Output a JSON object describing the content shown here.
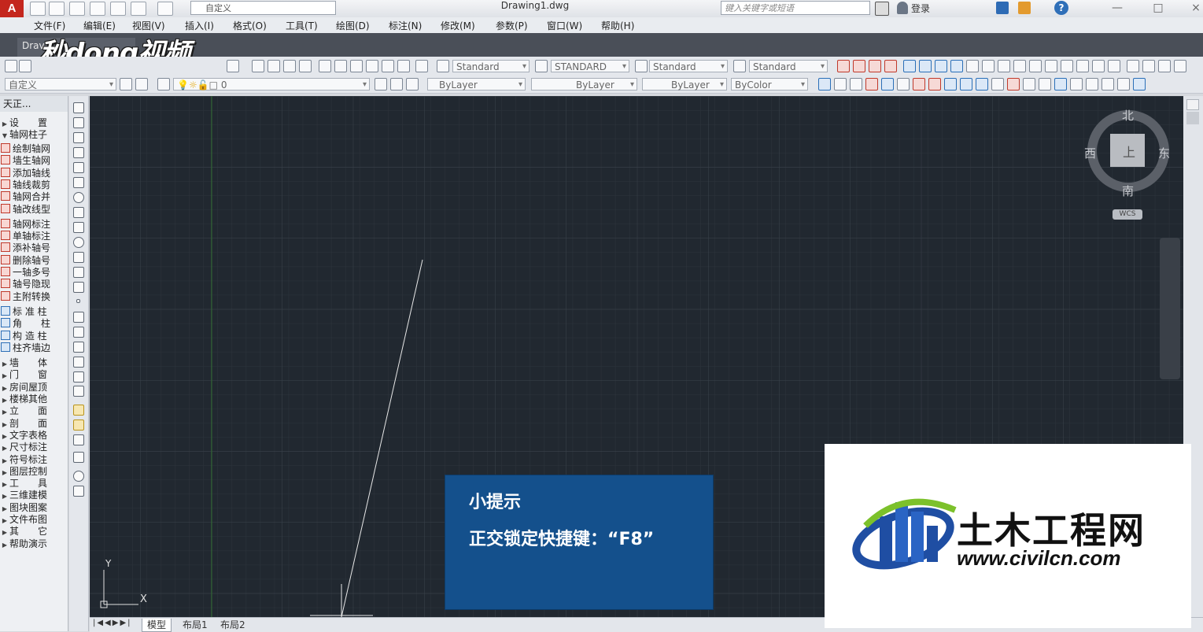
{
  "app": {
    "logo": "A",
    "title": "Drawing1.dwg",
    "workspace": "自定义",
    "search_placeholder": "键入关键字或短语",
    "login": "登录",
    "help": "?"
  },
  "menu": [
    "文件(F)",
    "编辑(E)",
    "视图(V)",
    "插入(I)",
    "格式(O)",
    "工具(T)",
    "绘图(D)",
    "标注(N)",
    "修改(M)",
    "参数(P)",
    "窗口(W)",
    "帮助(H)"
  ],
  "doc_tab": "Drav",
  "overlay_logo": "秒dong视频",
  "styles": {
    "text_style": "Standard",
    "dim_style": "STANDARD",
    "table_style": "Standard",
    "multileader_style": "Standard"
  },
  "layers": {
    "workspace2": "自定义",
    "current_layer": "0",
    "color": "ByLayer",
    "linetype": "ByLayer",
    "lineweight": "ByLayer",
    "plotstyle": "ByColor"
  },
  "palette": {
    "title": "天正...",
    "settings": "设　　置",
    "axis_group": "轴网柱子",
    "axis_items": [
      "绘制轴网",
      "墙生轴网",
      "添加轴线",
      "轴线裁剪",
      "轴网合并",
      "轴改线型",
      "轴网标注",
      "单轴标注",
      "添补轴号",
      "删除轴号",
      "一轴多号",
      "轴号隐现",
      "主附转换",
      "标 准 柱",
      "角　　柱",
      "构 造 柱",
      "柱齐墙边"
    ],
    "groups": [
      "墙　　体",
      "门　　窗",
      "房间屋顶",
      "楼梯其他",
      "立　　面",
      "剖　　面",
      "文字表格",
      "尺寸标注",
      "符号标注",
      "图层控制",
      "工　　具",
      "三维建模",
      "图块图案",
      "文件布图",
      "其　　它",
      "帮助演示"
    ]
  },
  "compass": {
    "north": "北",
    "south": "南",
    "east": "东",
    "west": "西",
    "top": "上",
    "wcs": "WCS"
  },
  "ucs": {
    "x": "X",
    "y": "Y"
  },
  "layout_tabs": [
    "模型",
    "布局1",
    "布局2"
  ],
  "hint": {
    "title": "小提示",
    "text": "正交锁定快捷键：“F8”"
  },
  "watermark": {
    "title": "土木工程网",
    "url": "www.civilcn.com"
  }
}
